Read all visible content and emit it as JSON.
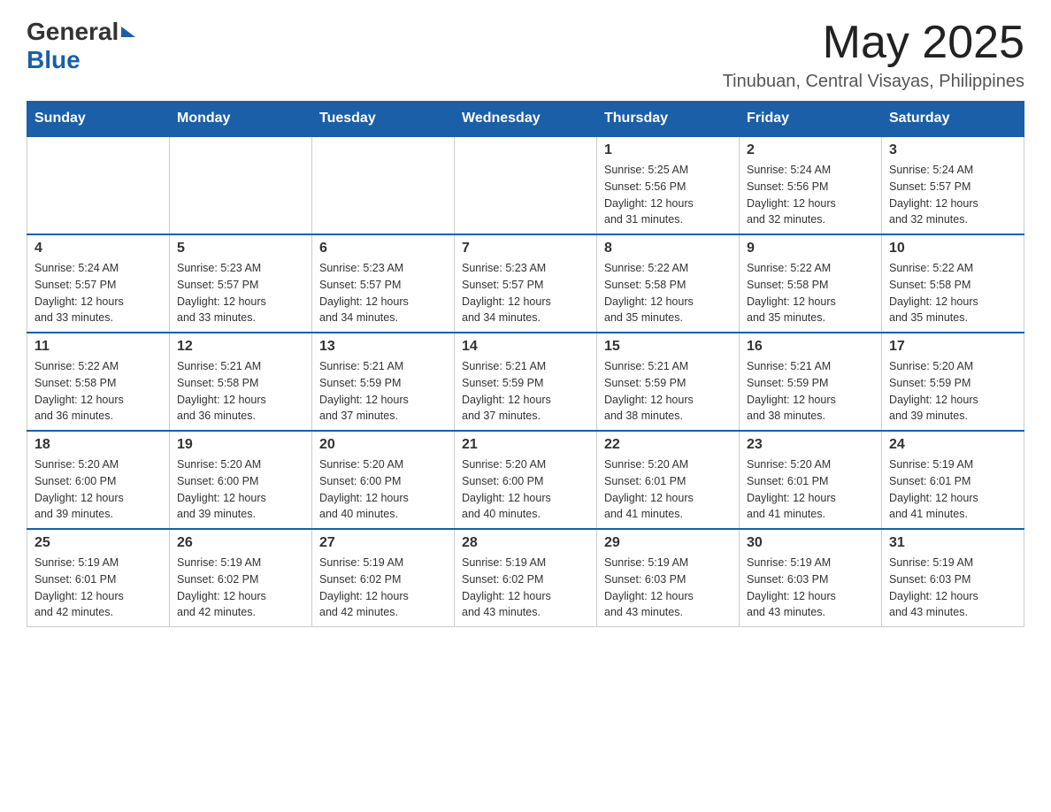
{
  "header": {
    "logo_general": "General",
    "logo_blue": "Blue",
    "month_title": "May 2025",
    "subtitle": "Tinubuan, Central Visayas, Philippines"
  },
  "calendar": {
    "days_of_week": [
      "Sunday",
      "Monday",
      "Tuesday",
      "Wednesday",
      "Thursday",
      "Friday",
      "Saturday"
    ],
    "weeks": [
      [
        {
          "day": "",
          "info": ""
        },
        {
          "day": "",
          "info": ""
        },
        {
          "day": "",
          "info": ""
        },
        {
          "day": "",
          "info": ""
        },
        {
          "day": "1",
          "info": "Sunrise: 5:25 AM\nSunset: 5:56 PM\nDaylight: 12 hours\nand 31 minutes."
        },
        {
          "day": "2",
          "info": "Sunrise: 5:24 AM\nSunset: 5:56 PM\nDaylight: 12 hours\nand 32 minutes."
        },
        {
          "day": "3",
          "info": "Sunrise: 5:24 AM\nSunset: 5:57 PM\nDaylight: 12 hours\nand 32 minutes."
        }
      ],
      [
        {
          "day": "4",
          "info": "Sunrise: 5:24 AM\nSunset: 5:57 PM\nDaylight: 12 hours\nand 33 minutes."
        },
        {
          "day": "5",
          "info": "Sunrise: 5:23 AM\nSunset: 5:57 PM\nDaylight: 12 hours\nand 33 minutes."
        },
        {
          "day": "6",
          "info": "Sunrise: 5:23 AM\nSunset: 5:57 PM\nDaylight: 12 hours\nand 34 minutes."
        },
        {
          "day": "7",
          "info": "Sunrise: 5:23 AM\nSunset: 5:57 PM\nDaylight: 12 hours\nand 34 minutes."
        },
        {
          "day": "8",
          "info": "Sunrise: 5:22 AM\nSunset: 5:58 PM\nDaylight: 12 hours\nand 35 minutes."
        },
        {
          "day": "9",
          "info": "Sunrise: 5:22 AM\nSunset: 5:58 PM\nDaylight: 12 hours\nand 35 minutes."
        },
        {
          "day": "10",
          "info": "Sunrise: 5:22 AM\nSunset: 5:58 PM\nDaylight: 12 hours\nand 35 minutes."
        }
      ],
      [
        {
          "day": "11",
          "info": "Sunrise: 5:22 AM\nSunset: 5:58 PM\nDaylight: 12 hours\nand 36 minutes."
        },
        {
          "day": "12",
          "info": "Sunrise: 5:21 AM\nSunset: 5:58 PM\nDaylight: 12 hours\nand 36 minutes."
        },
        {
          "day": "13",
          "info": "Sunrise: 5:21 AM\nSunset: 5:59 PM\nDaylight: 12 hours\nand 37 minutes."
        },
        {
          "day": "14",
          "info": "Sunrise: 5:21 AM\nSunset: 5:59 PM\nDaylight: 12 hours\nand 37 minutes."
        },
        {
          "day": "15",
          "info": "Sunrise: 5:21 AM\nSunset: 5:59 PM\nDaylight: 12 hours\nand 38 minutes."
        },
        {
          "day": "16",
          "info": "Sunrise: 5:21 AM\nSunset: 5:59 PM\nDaylight: 12 hours\nand 38 minutes."
        },
        {
          "day": "17",
          "info": "Sunrise: 5:20 AM\nSunset: 5:59 PM\nDaylight: 12 hours\nand 39 minutes."
        }
      ],
      [
        {
          "day": "18",
          "info": "Sunrise: 5:20 AM\nSunset: 6:00 PM\nDaylight: 12 hours\nand 39 minutes."
        },
        {
          "day": "19",
          "info": "Sunrise: 5:20 AM\nSunset: 6:00 PM\nDaylight: 12 hours\nand 39 minutes."
        },
        {
          "day": "20",
          "info": "Sunrise: 5:20 AM\nSunset: 6:00 PM\nDaylight: 12 hours\nand 40 minutes."
        },
        {
          "day": "21",
          "info": "Sunrise: 5:20 AM\nSunset: 6:00 PM\nDaylight: 12 hours\nand 40 minutes."
        },
        {
          "day": "22",
          "info": "Sunrise: 5:20 AM\nSunset: 6:01 PM\nDaylight: 12 hours\nand 41 minutes."
        },
        {
          "day": "23",
          "info": "Sunrise: 5:20 AM\nSunset: 6:01 PM\nDaylight: 12 hours\nand 41 minutes."
        },
        {
          "day": "24",
          "info": "Sunrise: 5:19 AM\nSunset: 6:01 PM\nDaylight: 12 hours\nand 41 minutes."
        }
      ],
      [
        {
          "day": "25",
          "info": "Sunrise: 5:19 AM\nSunset: 6:01 PM\nDaylight: 12 hours\nand 42 minutes."
        },
        {
          "day": "26",
          "info": "Sunrise: 5:19 AM\nSunset: 6:02 PM\nDaylight: 12 hours\nand 42 minutes."
        },
        {
          "day": "27",
          "info": "Sunrise: 5:19 AM\nSunset: 6:02 PM\nDaylight: 12 hours\nand 42 minutes."
        },
        {
          "day": "28",
          "info": "Sunrise: 5:19 AM\nSunset: 6:02 PM\nDaylight: 12 hours\nand 43 minutes."
        },
        {
          "day": "29",
          "info": "Sunrise: 5:19 AM\nSunset: 6:03 PM\nDaylight: 12 hours\nand 43 minutes."
        },
        {
          "day": "30",
          "info": "Sunrise: 5:19 AM\nSunset: 6:03 PM\nDaylight: 12 hours\nand 43 minutes."
        },
        {
          "day": "31",
          "info": "Sunrise: 5:19 AM\nSunset: 6:03 PM\nDaylight: 12 hours\nand 43 minutes."
        }
      ]
    ]
  }
}
